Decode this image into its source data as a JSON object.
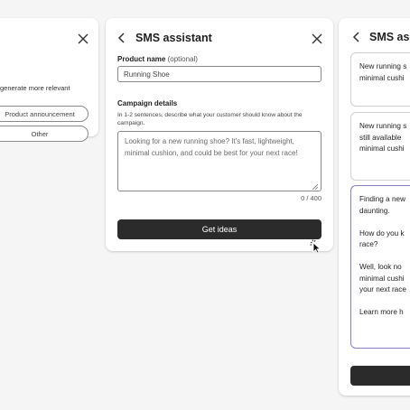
{
  "left_card": {
    "hint_text": "generate more relevant",
    "options": [
      "Product announcement",
      "Other"
    ]
  },
  "main_card": {
    "title": "SMS assistant",
    "product_name_label": "Product name",
    "product_name_optional": "(optional)",
    "product_name_value": "Running Shoe",
    "campaign_label": "Campaign details",
    "campaign_description": "In 1-2 sentences, describe what your customer should know about the campaign.",
    "campaign_placeholder": "Looking for a new running shoe? It's fast, lightweight, minimal cushion, and could be best for your next race!",
    "char_counter": "0 / 400",
    "submit_label": "Get ideas"
  },
  "right_card": {
    "title": "SMS assist",
    "suggestions": [
      {
        "lines": [
          "New running s",
          "minimal cushi"
        ]
      },
      {
        "lines": [
          "New running s",
          "still available",
          "minimal cushi"
        ]
      },
      {
        "paragraphs": [
          [
            "Finding a new",
            "daunting."
          ],
          [
            "How do you k",
            "race?"
          ],
          [
            "Well, look no",
            "minimal cushi",
            "your next race"
          ],
          [
            "Learn more h"
          ]
        ]
      }
    ]
  },
  "colors": {
    "primary_button": "#2b2b2b",
    "selected_border": "#8a7ec4",
    "card_background": "#ffffff",
    "page_background": "#f5f5f5"
  },
  "icons": [
    "close-icon",
    "back-chevron-icon",
    "resize-grip-icon",
    "cursor-icon"
  ]
}
